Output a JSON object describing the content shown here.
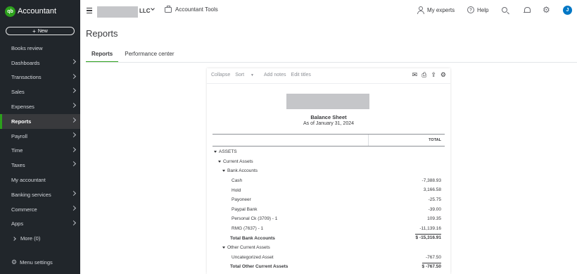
{
  "brand": {
    "logo_text": "qb",
    "name": "Accountant"
  },
  "new_button": {
    "label": "New"
  },
  "nav": {
    "items": [
      {
        "label": "Books review",
        "chevron": false,
        "active": false
      },
      {
        "label": "Dashboards",
        "chevron": true,
        "active": false
      },
      {
        "label": "Transactions",
        "chevron": true,
        "active": false
      },
      {
        "label": "Sales",
        "chevron": true,
        "active": false
      },
      {
        "label": "Expenses",
        "chevron": true,
        "active": false
      },
      {
        "label": "Reports",
        "chevron": true,
        "active": true
      },
      {
        "label": "Payroll",
        "chevron": true,
        "active": false
      },
      {
        "label": "Time",
        "chevron": true,
        "active": false
      },
      {
        "label": "Taxes",
        "chevron": true,
        "active": false
      },
      {
        "label": "My accountant",
        "chevron": false,
        "active": false
      },
      {
        "label": "Banking services",
        "chevron": true,
        "active": false
      },
      {
        "label": "Commerce",
        "chevron": true,
        "active": false
      },
      {
        "label": "Apps",
        "chevron": true,
        "active": false
      }
    ],
    "more_label": "More (0)",
    "menu_settings_label": "Menu settings"
  },
  "topbar": {
    "company_suffix": "LLC",
    "tools_label": "Accountant Tools",
    "experts_label": "My experts",
    "help_label": "Help",
    "avatar_initial": "J"
  },
  "page": {
    "title": "Reports",
    "tabs": [
      {
        "label": "Reports",
        "active": true
      },
      {
        "label": "Performance center",
        "active": false
      }
    ]
  },
  "report": {
    "toolbar": {
      "collapse": "Collapse",
      "sort": "Sort",
      "add_notes": "Add notes",
      "edit_titles": "Edit titles"
    },
    "title": "Balance Sheet",
    "subtitle": "As of January 31, 2024",
    "column_header": "TOTAL",
    "rows": [
      {
        "label": "ASSETS",
        "value": "",
        "level": 0,
        "toggle": true,
        "total": false
      },
      {
        "label": "Current Assets",
        "value": "",
        "level": 1,
        "toggle": true,
        "total": false
      },
      {
        "label": "Bank Accounts",
        "value": "",
        "level": 2,
        "toggle": true,
        "total": false
      },
      {
        "label": "Cash",
        "value": "-7,388.93",
        "level": 3,
        "toggle": false,
        "total": false
      },
      {
        "label": "Hold",
        "value": "3,166.58",
        "level": 3,
        "toggle": false,
        "total": false
      },
      {
        "label": "Payoneer",
        "value": "-25.75",
        "level": 3,
        "toggle": false,
        "total": false
      },
      {
        "label": "Paypal Bank",
        "value": "-39.00",
        "level": 3,
        "toggle": false,
        "total": false
      },
      {
        "label": "Personal Ck (3709) - 1",
        "value": "109.35",
        "level": 3,
        "toggle": false,
        "total": false
      },
      {
        "label": "RMG (7637) - 1",
        "value": "-11,139.16",
        "level": 3,
        "toggle": false,
        "total": false
      },
      {
        "label": "Total Bank Accounts",
        "value": "$ -15,316.91",
        "level": "t",
        "toggle": false,
        "total": true
      },
      {
        "label": "Other Current Assets",
        "value": "",
        "level": 2,
        "toggle": true,
        "total": false
      },
      {
        "label": "Uncategorized Asset",
        "value": "-767.50",
        "level": 3,
        "toggle": false,
        "total": false
      },
      {
        "label": "Total Other Current Assets",
        "value": "$ -767.50",
        "level": "t",
        "toggle": false,
        "total": true
      }
    ]
  },
  "colors": {
    "sidebar_bg": "#21262b",
    "accent_green": "#2ca01c",
    "avatar_blue": "#0077c5"
  }
}
